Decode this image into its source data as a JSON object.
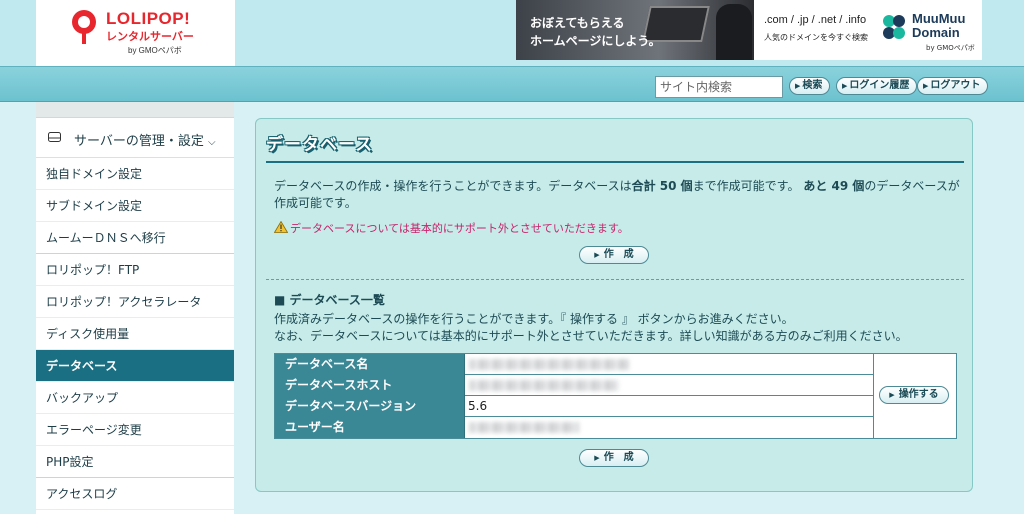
{
  "header": {
    "logo": {
      "name": "LOLIPOP!",
      "subtitle": "レンタルサーバー",
      "by": "by GMOペパボ"
    },
    "ad_left": {
      "line1": "おぼえてもらえる",
      "line2": "ホームページにしよう。"
    },
    "ad_right": {
      "domains": ".com / .jp / .net / .info",
      "catch": "人気のドメインを今すぐ検索",
      "brand_line1": "MuuMuu",
      "brand_line2": "Domain",
      "by": "by GMOペパボ"
    }
  },
  "topbar": {
    "search_placeholder": "サイト内検索",
    "search_button": "検索",
    "login_history_button": "ログイン履歴",
    "logout_button": "ログアウト"
  },
  "sidebar": {
    "section_label": "サーバーの管理・設定",
    "items": [
      {
        "label": "独自ドメイン設定"
      },
      {
        "label": "サブドメイン設定"
      },
      {
        "label": "ムームーＤＮＳへ移行"
      },
      {
        "label": "ロリポップ！FTP"
      },
      {
        "label": "ロリポップ！アクセラレータ"
      },
      {
        "label": "ディスク使用量"
      },
      {
        "label": "データベース"
      },
      {
        "label": "バックアップ"
      },
      {
        "label": "エラーページ変更"
      },
      {
        "label": "PHP設定"
      },
      {
        "label": "アクセスログ"
      }
    ]
  },
  "main": {
    "title": "データベース",
    "intro_part1": "データベースの作成・操作を行うことができます。データベースは",
    "intro_total": "合計 50 個",
    "intro_part2": "まで作成可能です。",
    "intro_remaining": "あと 49 個",
    "intro_part3": "のデータベースが作成可能です。",
    "warning": "データベースについては基本的にサポート外とさせていただきます。",
    "create_button": "作　成",
    "list_heading": "■ データベース一覧",
    "list_desc_line1": "作成済みデータベースの操作を行うことができます。『 操作する 』 ボタンからお進みください。",
    "list_desc_line2": "なお、データベースについては基本的にサポート外とさせていただきます。詳しい知識がある方のみご利用ください。",
    "table": {
      "rows": [
        {
          "label": "データベース名",
          "value": ""
        },
        {
          "label": "データベースホスト",
          "value": ""
        },
        {
          "label": "データベースバージョン",
          "value": "5.6"
        },
        {
          "label": "ユーザー名",
          "value": ""
        }
      ],
      "operate_button": "操作する"
    },
    "create_button_bottom": "作　成"
  }
}
